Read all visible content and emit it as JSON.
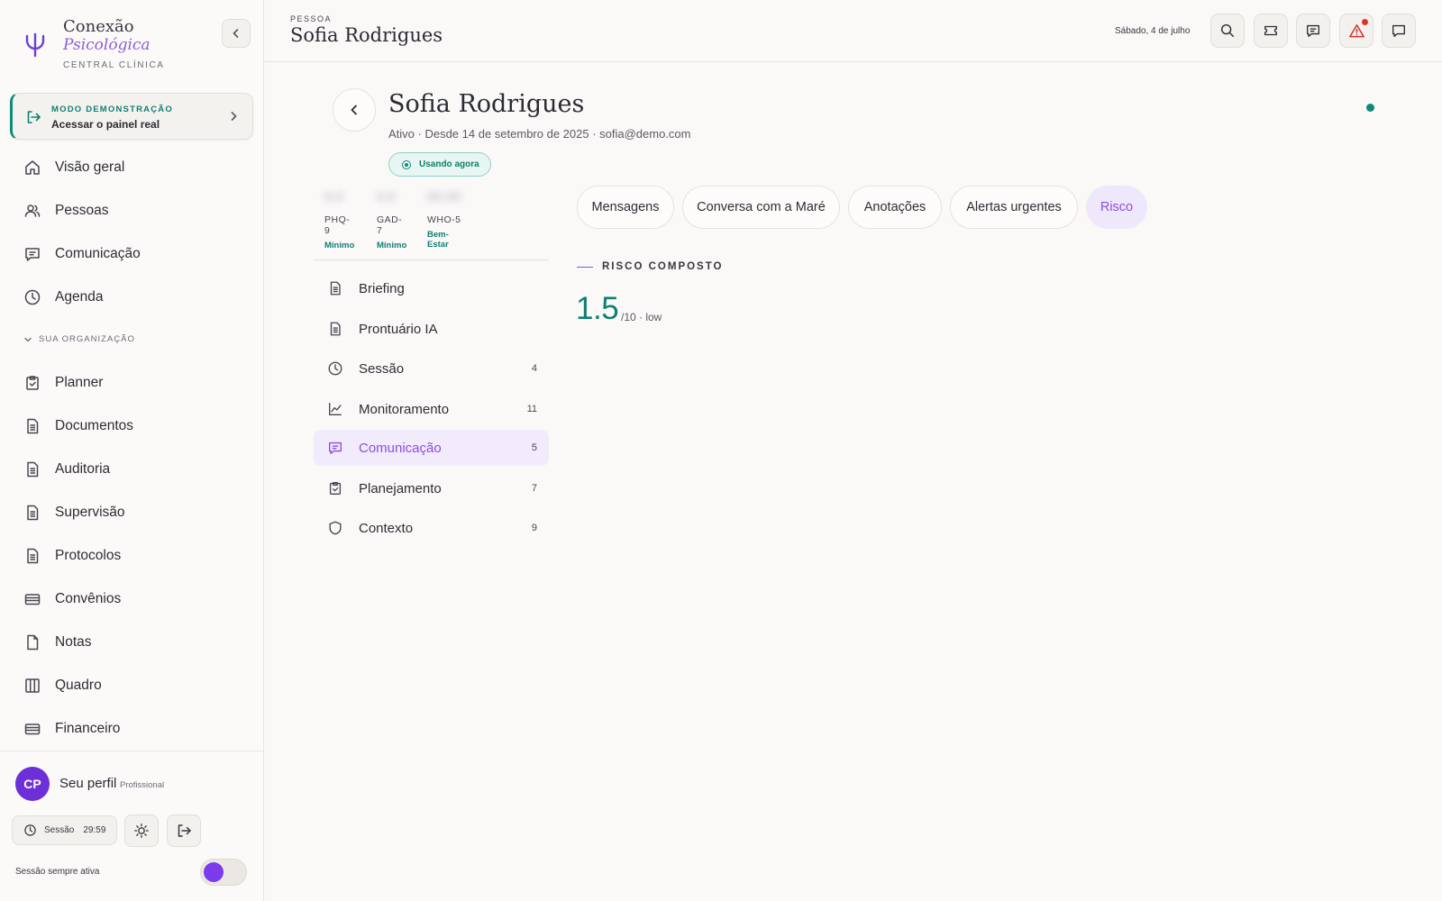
{
  "brand": {
    "line1": "Conexão",
    "line2": "Psicológica",
    "line3": "CENTRAL CLÍNICA"
  },
  "demo": {
    "kicker": "MODO DEMONSTRAÇÃO",
    "label": "Acessar o painel real"
  },
  "sidebar": {
    "main_items": [
      {
        "label": "Visão geral",
        "icon": "home-icon"
      },
      {
        "label": "Pessoas",
        "icon": "people-icon"
      },
      {
        "label": "Comunicação",
        "icon": "chat-icon"
      },
      {
        "label": "Agenda",
        "icon": "clock-icon"
      }
    ],
    "section_label": "SUA ORGANIZAÇÃO",
    "org_items": [
      {
        "label": "Planner",
        "icon": "clipboard-icon"
      },
      {
        "label": "Documentos",
        "icon": "document-icon"
      },
      {
        "label": "Auditoria",
        "icon": "document-icon"
      },
      {
        "label": "Supervisão",
        "icon": "document-icon"
      },
      {
        "label": "Protocolos",
        "icon": "document-icon"
      },
      {
        "label": "Convênios",
        "icon": "card-icon"
      },
      {
        "label": "Notas",
        "icon": "file-icon"
      },
      {
        "label": "Quadro",
        "icon": "columns-icon"
      },
      {
        "label": "Financeiro",
        "icon": "card-icon"
      }
    ]
  },
  "profile": {
    "initials": "CP",
    "name": "Seu perfil",
    "role": "Profissional"
  },
  "session": {
    "label": "Sessão",
    "time": "29:59",
    "always_active_label": "Sessão sempre ativa",
    "always_active": true
  },
  "header": {
    "kicker": "PESSOA",
    "title": "Sofia Rodrigues",
    "date": "Sábado, 4 de julho"
  },
  "person": {
    "name": "Sofia Rodrigues",
    "meta": "Ativo · Desde 14 de setembro de 2025 · sofia@demo.com",
    "badge": "Usando agora"
  },
  "scores": [
    {
      "value": "0.0",
      "name": "PHQ-9",
      "level": "Mínimo"
    },
    {
      "value": "0.0",
      "name": "GAD-7",
      "level": "Mínimo"
    },
    {
      "value": "00.00",
      "name": "WHO-5",
      "level": "Bem-Estar"
    }
  ],
  "subnav": [
    {
      "label": "Briefing",
      "count": "",
      "icon": "document-icon",
      "active": false
    },
    {
      "label": "Prontuário IA",
      "count": "",
      "icon": "document-icon",
      "active": false
    },
    {
      "label": "Sessão",
      "count": "4",
      "icon": "clock-icon",
      "active": false
    },
    {
      "label": "Monitoramento",
      "count": "11",
      "icon": "chart-line-icon",
      "active": false
    },
    {
      "label": "Comunicação",
      "count": "5",
      "icon": "chat-icon",
      "active": true
    },
    {
      "label": "Planejamento",
      "count": "7",
      "icon": "clipboard-icon",
      "active": false
    },
    {
      "label": "Contexto",
      "count": "9",
      "icon": "shield-icon",
      "active": false
    }
  ],
  "tabs": [
    {
      "label": "Mensagens",
      "active": false
    },
    {
      "label": "Conversa com a Maré",
      "active": false
    },
    {
      "label": "Anotações",
      "active": false
    },
    {
      "label": "Alertas urgentes",
      "active": false
    },
    {
      "label": "Risco",
      "active": true
    }
  ],
  "risk": {
    "label": "RISCO COMPOSTO",
    "value": "1.5",
    "suffix": "/10 · low"
  },
  "colors": {
    "accent": "#8a4fe0",
    "teal": "#0f7f70",
    "alert": "#d0312d",
    "avatar": "#6d2fd8"
  }
}
